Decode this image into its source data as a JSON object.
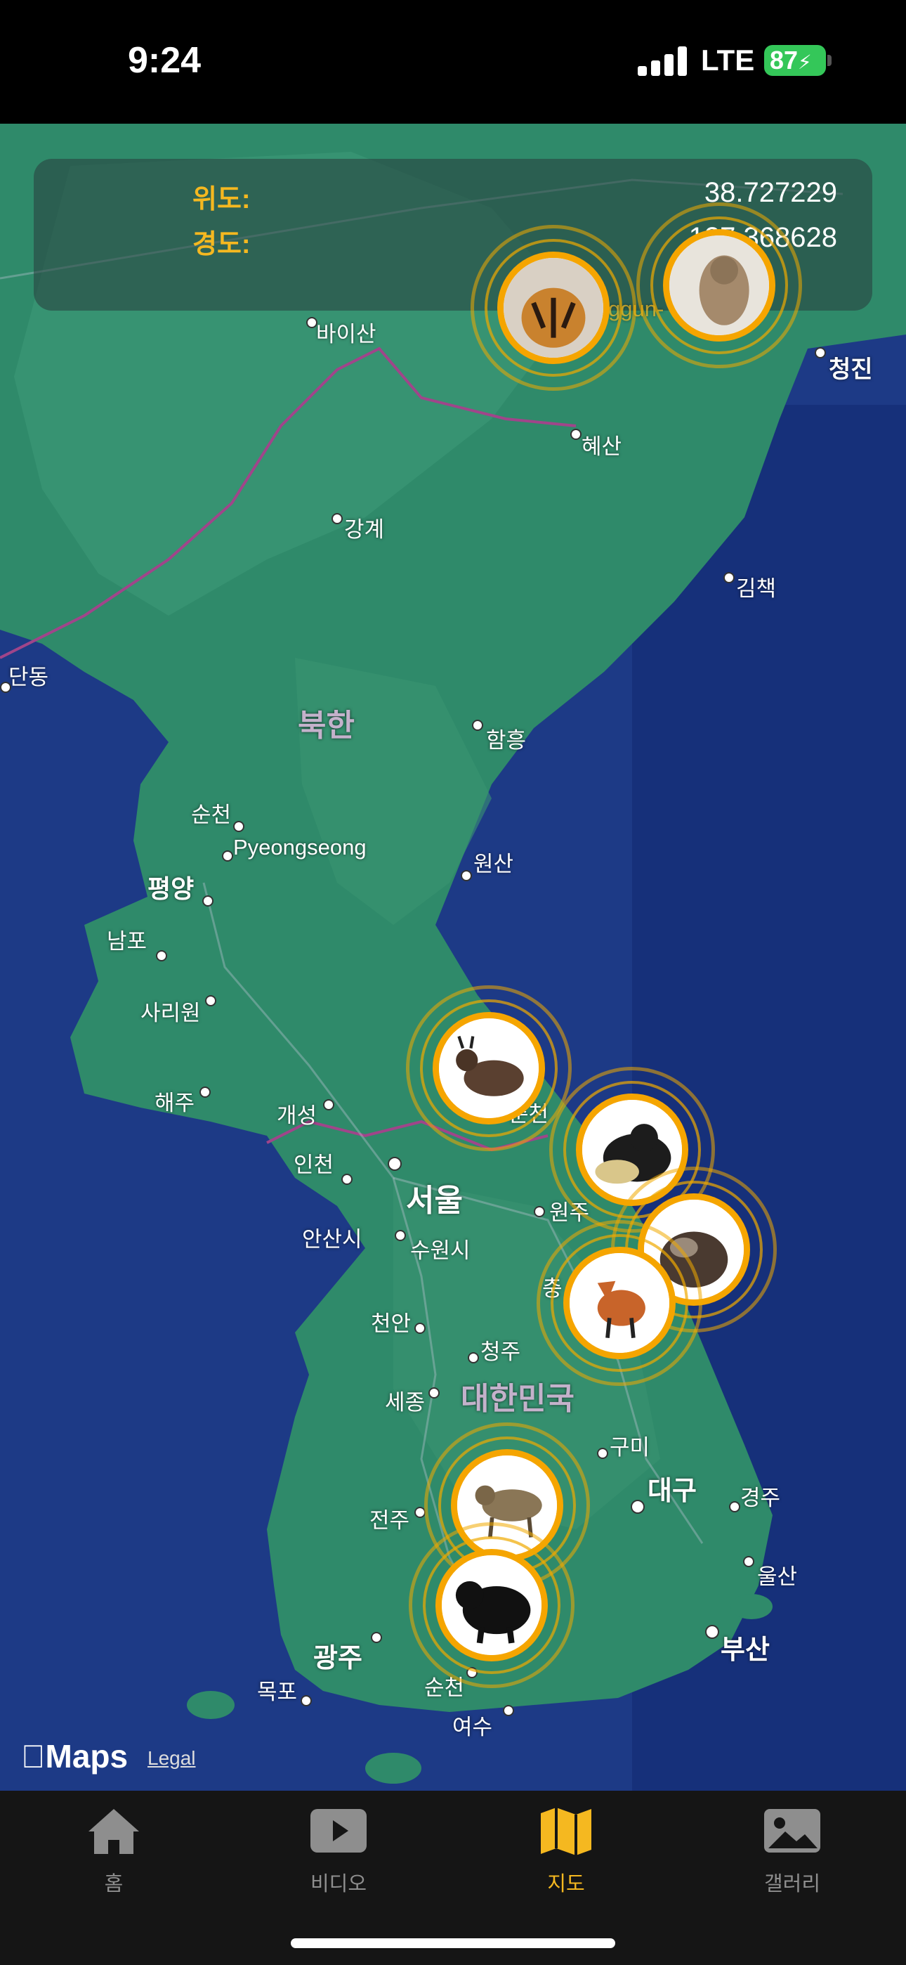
{
  "status": {
    "time": "9:24",
    "network": "LTE",
    "battery": "87"
  },
  "coords": {
    "lat_label": "위도:",
    "lat_value": "38.727229",
    "lng_label": "경도:",
    "lng_value": "127.368628"
  },
  "map_labels": {
    "baisan": "바이산",
    "cheongjin": "청진",
    "hyesan": "혜산",
    "ganggye": "강계",
    "gimchaek": "김책",
    "dandong": "단동",
    "bukhan": "북한",
    "hamheung": "함흥",
    "suncheon_n": "순천",
    "pyeongseong": "Pyeongseong",
    "pyongyang": "평양",
    "wonsan": "원산",
    "nampo": "남포",
    "sariwon": "사리원",
    "haeju": "해주",
    "kaesong": "개성",
    "chuncheon": "춘천",
    "incheon": "인천",
    "seoul": "서울",
    "wonju": "원주",
    "ansan": "안산시",
    "suwon": "수원시",
    "cheonan": "천안",
    "cheongju": "청주",
    "sejong": "세종",
    "daehanminguk": "대한민국",
    "gumi": "구미",
    "daegu": "대구",
    "gyeongju": "경주",
    "jeonju": "전주",
    "ulsan": "울산",
    "busan": "부산",
    "gwangju": "광주",
    "mokpo": "목포",
    "suncheon_s": "순천",
    "yeosu": "여수",
    "chung": "충",
    "cheon_fragment": "춘천",
    "gun_fragment": "ggun-"
  },
  "markers": [
    "tiger",
    "lynx",
    "goral",
    "marten",
    "otter",
    "fox",
    "leopard-cat",
    "black-bear"
  ],
  "attribution": {
    "maps": "Maps",
    "legal": "Legal"
  },
  "tabs": [
    {
      "label": "홈",
      "icon": "house-icon"
    },
    {
      "label": "비디오",
      "icon": "play-icon"
    },
    {
      "label": "지도",
      "icon": "map-icon",
      "active": true
    },
    {
      "label": "갤러리",
      "icon": "photo-icon"
    }
  ],
  "colors": {
    "accent": "#f5b820",
    "land": "#2f8a6a",
    "sea": "#1d3a86"
  }
}
